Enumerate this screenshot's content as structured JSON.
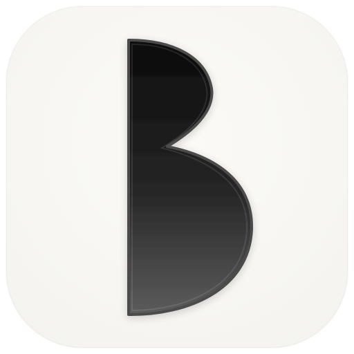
{
  "icon": {
    "name": "B app icon",
    "background_color": "#f7f6f2",
    "glyph_color_top": "#0b0b0b",
    "glyph_color_bottom": "#5a5a5a",
    "outline_color": "#4a4a4a"
  }
}
